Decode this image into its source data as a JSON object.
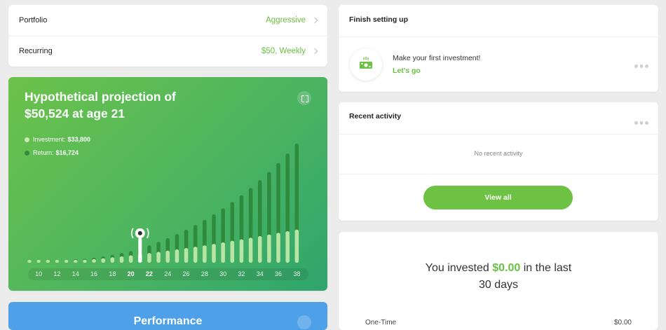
{
  "portfolio": {
    "portfolio_label": "Portfolio",
    "portfolio_value": "Aggressive",
    "recurring_label": "Recurring",
    "recurring_value": "$50, Weekly"
  },
  "projection": {
    "title_line1": "Hypothetical projection of",
    "title_line2": "$50,524 at age 21",
    "legend": [
      {
        "label": "Investment:",
        "value": "$33,800",
        "color": "#c8ecb3"
      },
      {
        "label": "Return:",
        "value": "$16,724",
        "color": "#2f8a3e"
      }
    ],
    "selected_age": "21"
  },
  "chart_data": {
    "type": "bar",
    "stacked": true,
    "x_tick_labels": [
      "10",
      "12",
      "14",
      "16",
      "18",
      "20",
      "22",
      "24",
      "26",
      "28",
      "30",
      "32",
      "34",
      "36",
      "38"
    ],
    "x_range": [
      9,
      39
    ],
    "series": [
      {
        "name": "Investment",
        "values": [
          0.2,
          0.4,
          0.7,
          1.1,
          1.6,
          2.2,
          2.9,
          3.6,
          4.4,
          5.3,
          6.2,
          7.2,
          8.3,
          9.4,
          10.6,
          11.8,
          13.0,
          14.3,
          15.6,
          17.0,
          18.4,
          19.9,
          21.4,
          22.9,
          24.4,
          26.0,
          27.6,
          29.2,
          30.8,
          32.4
        ]
      },
      {
        "name": "Return",
        "values": [
          0,
          0.05,
          0.1,
          0.2,
          0.3,
          0.5,
          0.8,
          1.2,
          1.7,
          2.3,
          3.2,
          4.3,
          5.8,
          7.6,
          9.8,
          12.3,
          15.0,
          18.0,
          21.3,
          24.9,
          28.9,
          33.2,
          38.0,
          43.1,
          48.7,
          54.7,
          61.2,
          68.3,
          75.9,
          84.1
        ]
      }
    ],
    "colors": {
      "investment": "#b8e5a4",
      "return": "#2e8b3d"
    }
  },
  "performance": {
    "title": "Performance"
  },
  "setup": {
    "header": "Finish setting up",
    "item_title": "Make your first investment!",
    "item_link": "Let's go"
  },
  "activity": {
    "header": "Recent activity",
    "empty": "No recent activity",
    "button": "View all"
  },
  "invested": {
    "prefix": "You invested",
    "amount": "$0.00",
    "suffix_line1": "in the last",
    "suffix_line2": "30 days",
    "row_label": "One-Time",
    "row_value": "$0.00"
  },
  "colors": {
    "accent": "#69c043",
    "blue": "#4ea1e8"
  }
}
